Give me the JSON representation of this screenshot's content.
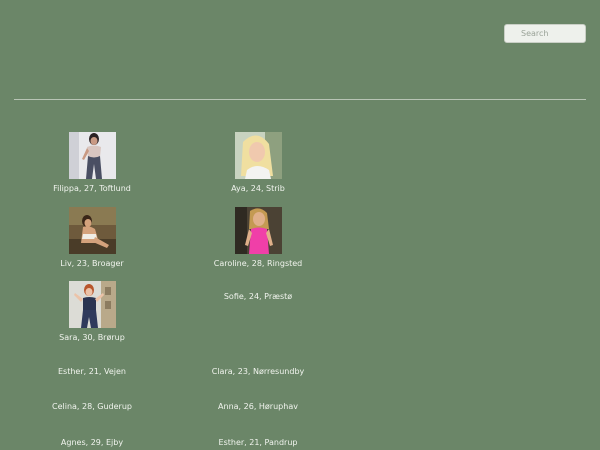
{
  "search": {
    "placeholder": "Search"
  },
  "profiles": [
    {
      "caption": "Filippa, 27, Toftlund",
      "photo": "photo-woman-leggings"
    },
    {
      "caption": "Aya, 24, Strib",
      "photo": "photo-woman-blonde"
    },
    {
      "caption": "Liv, 23, Broager",
      "photo": "photo-woman-outdoor"
    },
    {
      "caption": "Caroline, 28, Ringsted",
      "photo": "photo-woman-pink"
    },
    {
      "caption": "Sara, 30, Brørup",
      "photo": "photo-woman-redhead"
    },
    {
      "caption": "Sofie, 24, Præstø"
    },
    {
      "caption": "Esther, 21, Vejen"
    },
    {
      "caption": "Clara, 23, Nørresundby"
    },
    {
      "caption": "Celina, 28, Guderup"
    },
    {
      "caption": "Anna, 26, Høruphav"
    },
    {
      "caption": "Agnes, 29, Ejby"
    },
    {
      "caption": "Esther, 21, Pandrup"
    }
  ]
}
